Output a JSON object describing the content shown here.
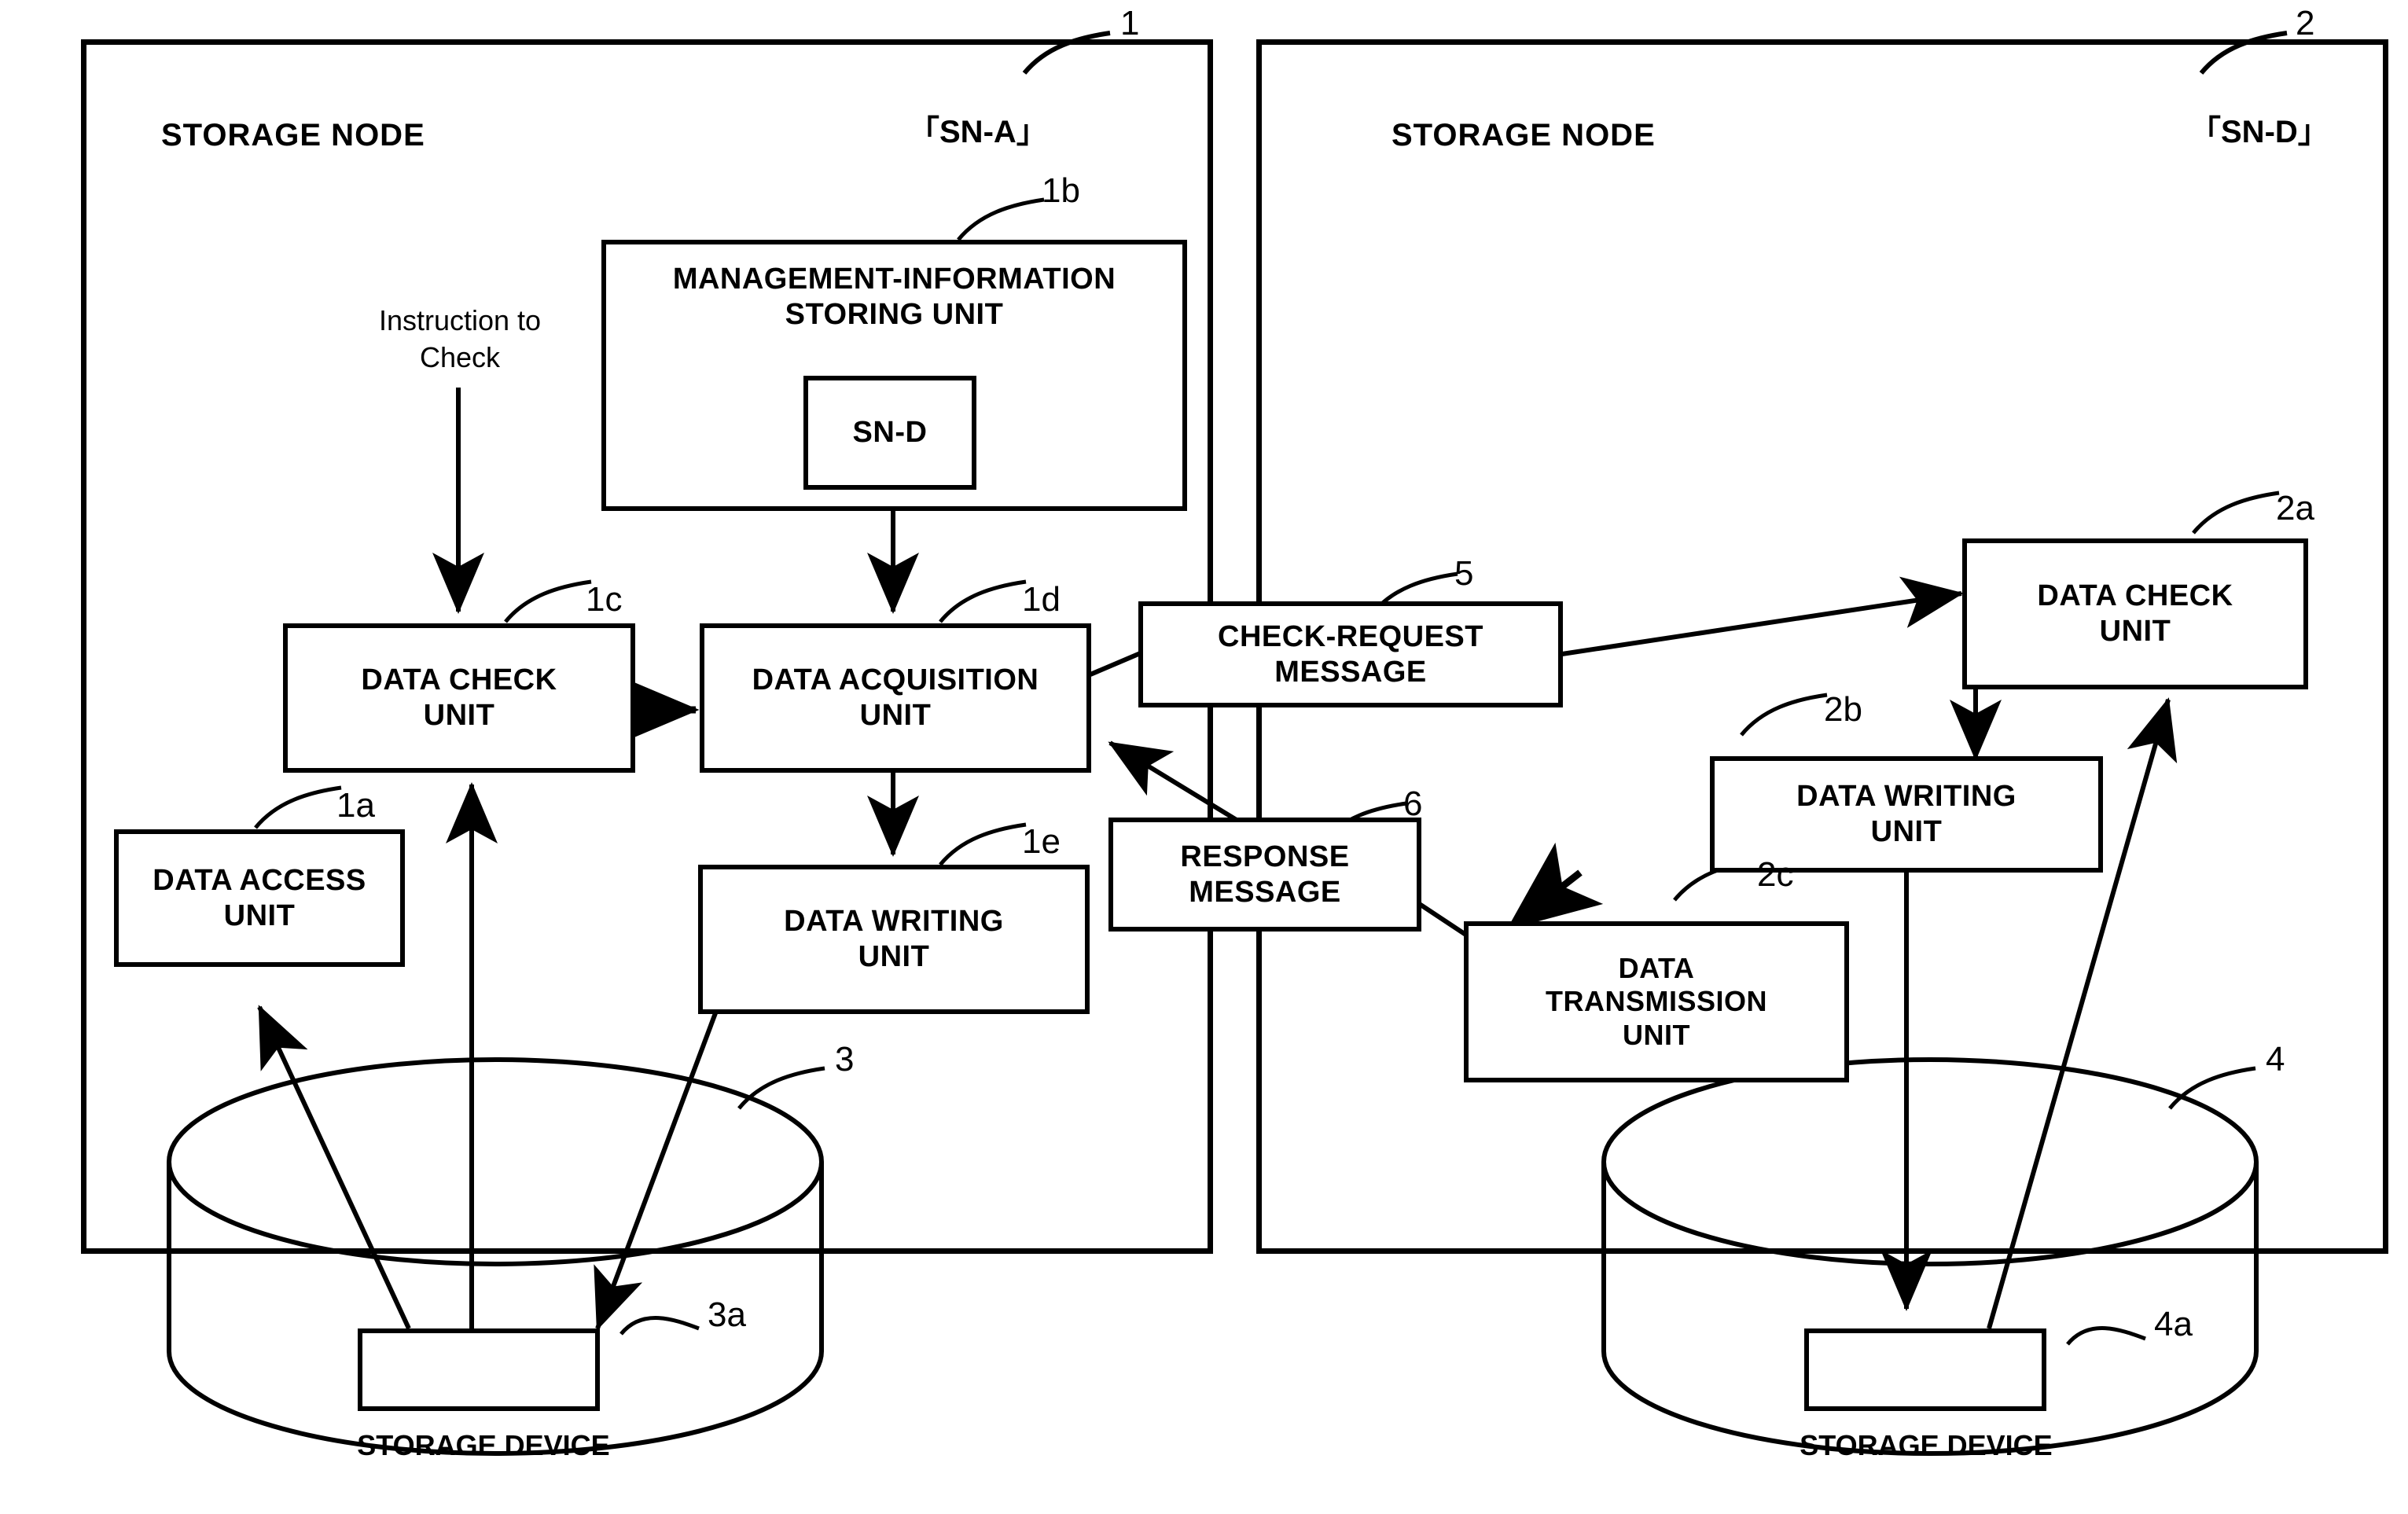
{
  "figure": {
    "nodes": [
      {
        "ref": "1",
        "title": "STORAGE NODE",
        "tag": "「SN-A」"
      },
      {
        "ref": "2",
        "title": "STORAGE NODE",
        "tag": "「SN-D」"
      }
    ],
    "left_node": {
      "management_unit": {
        "ref": "1b",
        "label": "MANAGEMENT-INFORMATION\nSTORING UNIT",
        "entry": "SN-D"
      },
      "instruction_label": "Instruction to\nCheck",
      "data_check_unit": {
        "ref": "1c",
        "label": "DATA CHECK\nUNIT"
      },
      "data_acquisition_unit": {
        "ref": "1d",
        "label": "DATA ACQUISITION\nUNIT"
      },
      "data_access_unit": {
        "ref": "1a",
        "label": "DATA ACCESS\nUNIT"
      },
      "data_writing_unit": {
        "ref": "1e",
        "label": "DATA WRITING\nUNIT"
      }
    },
    "right_node": {
      "data_check_unit": {
        "ref": "2a",
        "label": "DATA CHECK\nUNIT"
      },
      "data_writing_unit": {
        "ref": "2b",
        "label": "DATA WRITING\nUNIT"
      },
      "data_transmission_unit": {
        "ref": "2c",
        "label": "DATA\nTRANSMISSION\nUNIT"
      }
    },
    "messages": [
      {
        "ref": "5",
        "label": "CHECK-REQUEST\nMESSAGE"
      },
      {
        "ref": "6",
        "label": "RESPONSE\nMESSAGE"
      }
    ],
    "storage_devices": [
      {
        "ref": "3",
        "label": "STORAGE DEVICE",
        "data_ref": "3a"
      },
      {
        "ref": "4",
        "label": "STORAGE DEVICE",
        "data_ref": "4a"
      }
    ]
  }
}
